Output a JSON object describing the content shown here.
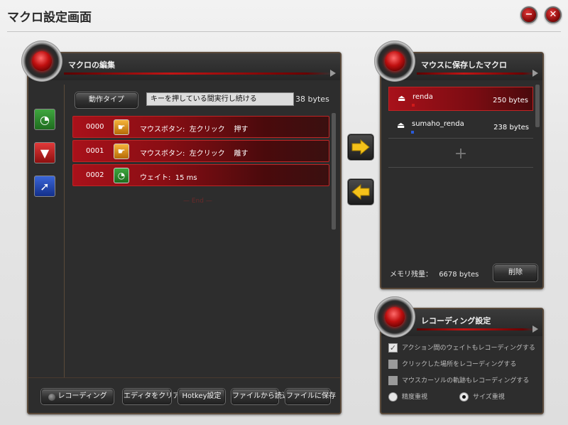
{
  "window": {
    "title": "マクロ設定画面",
    "minimize_icon": "minimize-icon",
    "close_icon": "close-icon"
  },
  "editor": {
    "title": "マクロの編集",
    "action_type_button": "動作タイプ",
    "description": "キーを押している間実行し続ける",
    "size": "38 bytes",
    "side_icons": [
      "wait-icon",
      "mouse-click-icon",
      "cursor-icon"
    ],
    "rows": [
      {
        "num": "0000",
        "icon": "mouse-button-icon",
        "text": "マウスボタン:  左クリック    押す"
      },
      {
        "num": "0001",
        "icon": "mouse-button-icon",
        "text": "マウスボタン:  左クリック    離す"
      },
      {
        "num": "0002",
        "icon": "wait-icon",
        "text": "ウェイト:  15 ms"
      }
    ],
    "end_label": "— End —",
    "footer_buttons": {
      "record": "レコーディング",
      "clear": "エディタをクリア",
      "hotkey": "Hotkey設定",
      "load": "ファイルから読込",
      "save": "ファイルに保存"
    }
  },
  "transfer": {
    "to_mouse": "arrow-right-icon",
    "to_editor": "arrow-left-icon"
  },
  "saved": {
    "title": "マウスに保存したマクロ",
    "items": [
      {
        "name": "renda",
        "size": "250 bytes",
        "selected": true,
        "marker_color": "#d01a1a"
      },
      {
        "name": "sumaho_renda",
        "size": "238 bytes",
        "selected": false,
        "marker_color": "#2a5ad8"
      }
    ],
    "add_icon": "plus-icon",
    "memory_label": "メモリ残量：",
    "memory_value": "6678 bytes",
    "delete_button": "削除"
  },
  "recording": {
    "title": "レコーディング設定",
    "options": [
      {
        "label": "アクション間のウェイトもレコーディングする",
        "checked": true
      },
      {
        "label": "クリックした場所をレコーディングする",
        "checked": false
      },
      {
        "label": "マウスカーソルの軌跡もレコーディングする",
        "checked": false
      }
    ],
    "radio_precision": "精度重視",
    "radio_size": "サイズ重視",
    "selected_radio": "サイズ重視"
  },
  "colors": {
    "accent_red": "#a8111a",
    "panel_bg": "#2d2d2d",
    "arrow_yellow": "#f5c21a"
  }
}
